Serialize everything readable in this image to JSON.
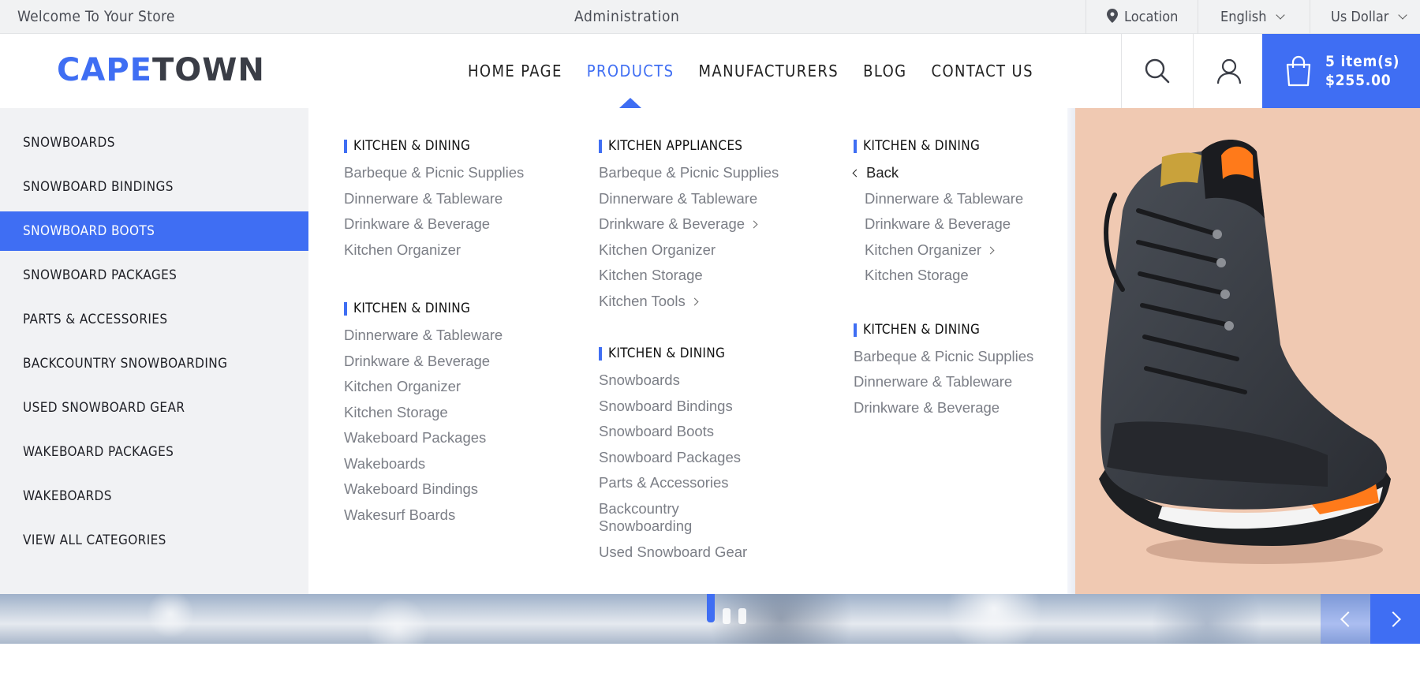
{
  "topbar": {
    "welcome": "Welcome To Your Store",
    "administration": "Administration",
    "location": "Location",
    "language": "English",
    "currency": "Us Dollar"
  },
  "header": {
    "logo_part1": "CAPE",
    "logo_part2": "TOWN",
    "nav": [
      "HOME PAGE",
      "PRODUCTS",
      "MANUFACTURERS",
      "BLOG",
      "CONTACT US"
    ],
    "active_nav": "PRODUCTS",
    "cart_items": "5 item(s)",
    "cart_total": "$255.00"
  },
  "sidebar": {
    "items": [
      "SNOWBOARDS",
      "SNOWBOARD BINDINGS",
      "SNOWBOARD BOOTS",
      "SNOWBOARD PACKAGES",
      "PARTS & ACCESSORIES",
      "BACKCOUNTRY SNOWBOARDING",
      "USED SNOWBOARD GEAR",
      "WAKEBOARD PACKAGES",
      "WAKEBOARDS",
      "VIEW ALL CATEGORIES"
    ],
    "active": "SNOWBOARD BOOTS"
  },
  "mega": {
    "col1": [
      {
        "title": "KITCHEN & DINING",
        "links": [
          "Barbeque & Picnic Supplies",
          "Dinnerware & Tableware",
          "Drinkware & Beverage",
          "Kitchen Organizer"
        ]
      },
      {
        "title": "KITCHEN & DINING",
        "links": [
          "Dinnerware & Tableware",
          "Drinkware & Beverage",
          "Kitchen Organizer",
          "Kitchen Storage",
          "Wakeboard Packages",
          "Wakeboards",
          "Wakeboard Bindings",
          "Wakesurf Boards"
        ]
      }
    ],
    "col2": [
      {
        "title": "KITCHEN APPLIANCES",
        "links": [
          "Barbeque & Picnic Supplies",
          "Dinnerware & Tableware",
          "Drinkware & Beverage",
          "Kitchen Organizer",
          "Kitchen Storage",
          "Kitchen Tools"
        ]
      },
      {
        "title": "KITCHEN & DINING",
        "links": [
          "Snowboards",
          "Snowboard Bindings",
          "Snowboard Boots",
          "Snowboard Packages",
          "Parts & Accessories",
          "Backcountry Snowboarding",
          "Used Snowboard Gear"
        ]
      }
    ],
    "col3": [
      {
        "title": "KITCHEN & DINING",
        "back": "Back",
        "links": [
          "Dinnerware & Tableware",
          "Drinkware & Beverage",
          "Kitchen Organizer",
          "Kitchen Storage"
        ]
      },
      {
        "title": "KITCHEN & DINING",
        "links": [
          "Barbeque & Picnic Supplies",
          "Dinnerware & Tableware",
          "Drinkware & Beverage"
        ]
      }
    ]
  },
  "colors": {
    "accent": "#3f6ef3",
    "sidebar_bg": "#f1f2f4",
    "topbar_bg": "#f1f2f3",
    "product_bg": "#f0c9b2"
  },
  "icons": [
    "location-pin-icon",
    "chevron-down-icon",
    "search-icon",
    "user-icon",
    "shopping-bag-icon",
    "chevron-right-icon",
    "chevron-left-icon"
  ]
}
